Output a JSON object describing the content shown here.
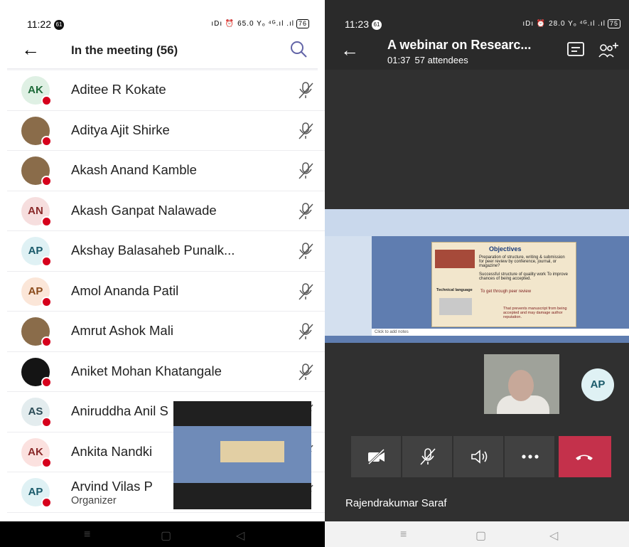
{
  "left_screen": {
    "status": {
      "time": "11:22",
      "badge": "61",
      "icons": "ıDı ⏰ 65.0 Yₒ ⁴ᴳ.ıl .ıl",
      "battery": "76"
    },
    "title": "In the meeting (56)",
    "participants": [
      {
        "initials": "AK",
        "name": "Aditee R Kokate",
        "avatar_bg": "#dff0e4",
        "avatar_fg": "#1f6a3a"
      },
      {
        "initials": "",
        "name": "Aditya Ajit Shirke",
        "photo": true
      },
      {
        "initials": "",
        "name": "Akash Anand Kamble",
        "photo": true
      },
      {
        "initials": "AN",
        "name": "Akash Ganpat Nalawade",
        "avatar_bg": "#f6dede",
        "avatar_fg": "#8a2a2a"
      },
      {
        "initials": "AP",
        "name": "Akshay Balasaheb Punalk...",
        "avatar_bg": "#dff1f4",
        "avatar_fg": "#1a5a6a"
      },
      {
        "initials": "AP",
        "name": "Amol Ananda Patil",
        "avatar_bg": "#fbe6d8",
        "avatar_fg": "#8a4a1a"
      },
      {
        "initials": "",
        "name": "Amrut Ashok Mali",
        "photo": true
      },
      {
        "initials": "",
        "name": "Aniket Mohan Khatangale",
        "photo": true
      },
      {
        "initials": "AS",
        "name": "Aniruddha Anil S",
        "avatar_bg": "#e3ecee",
        "avatar_fg": "#2a4a55"
      },
      {
        "initials": "AK",
        "name": "Ankita Nandki",
        "avatar_bg": "#fbe1df",
        "avatar_fg": "#8a2a2a"
      },
      {
        "initials": "AP",
        "name": "Arvind Vilas P",
        "role": "Organizer",
        "avatar_bg": "#dff1f4",
        "avatar_fg": "#1a5a6a"
      }
    ]
  },
  "right_screen": {
    "status": {
      "time": "11:23",
      "badge": "61",
      "icons": "ıDı ⏰ 28.0 Yₒ ⁴ᴳ.ıl .ıl",
      "battery": "75"
    },
    "title": "A webinar on Researc...",
    "duration": "01:37",
    "attendees": "57 attendees",
    "slide": {
      "heading": "Objectives",
      "line1": "Preparation of structure, writing & submission for peer review by conference, journal, or magazine?",
      "line2": "Successful structure of quality work To improve chances of being accepted.",
      "tech": "Technical language",
      "line3": "To get through peer review",
      "line4": "That prevents manuscript from being accepted and may damage author reputation.",
      "notes": "Click to add notes"
    },
    "other_participant_initials": "AP",
    "presenter_name": "Rajendrakumar Saraf"
  },
  "colors": {
    "accent": "#6264a7",
    "end_call": "#c4314b",
    "mute_dot": "#d6001c"
  }
}
